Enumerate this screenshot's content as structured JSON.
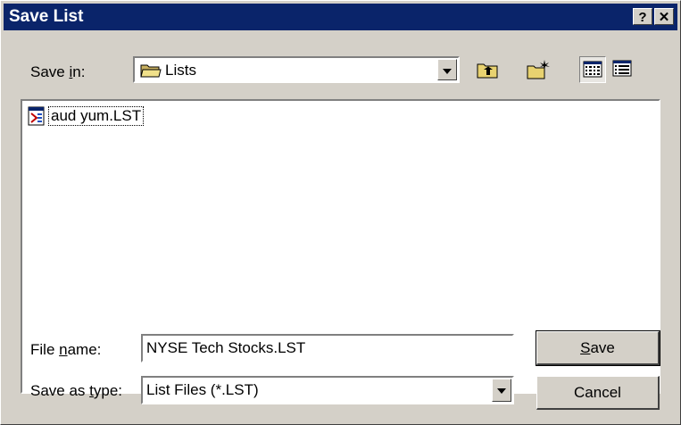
{
  "window": {
    "title": "Save List",
    "help_label": "?",
    "close_label": "✕"
  },
  "savein": {
    "label_pre": "Save ",
    "label_key": "i",
    "label_post": "n:",
    "folder": "Lists",
    "folder_icon": "folder-icon"
  },
  "toolbar": {
    "up_icon": "up-one-level-icon",
    "new_folder_icon": "new-folder-icon",
    "list_icon": "list-view-icon",
    "details_icon": "details-view-icon"
  },
  "files": [
    {
      "name": "aud yum.LST",
      "icon": "list-file-icon"
    }
  ],
  "filename": {
    "label_pre": "File ",
    "label_key": "n",
    "label_post": "ame:",
    "value": "NYSE Tech Stocks.LST"
  },
  "savetype": {
    "label_pre": "Save as ",
    "label_key": "t",
    "label_post": "ype:",
    "value": "List Files (*.LST)"
  },
  "buttons": {
    "save_key": "S",
    "save_rest": "ave",
    "cancel": "Cancel"
  },
  "colors": {
    "titlebar": "#0a246a",
    "face": "#d4d0c8"
  }
}
